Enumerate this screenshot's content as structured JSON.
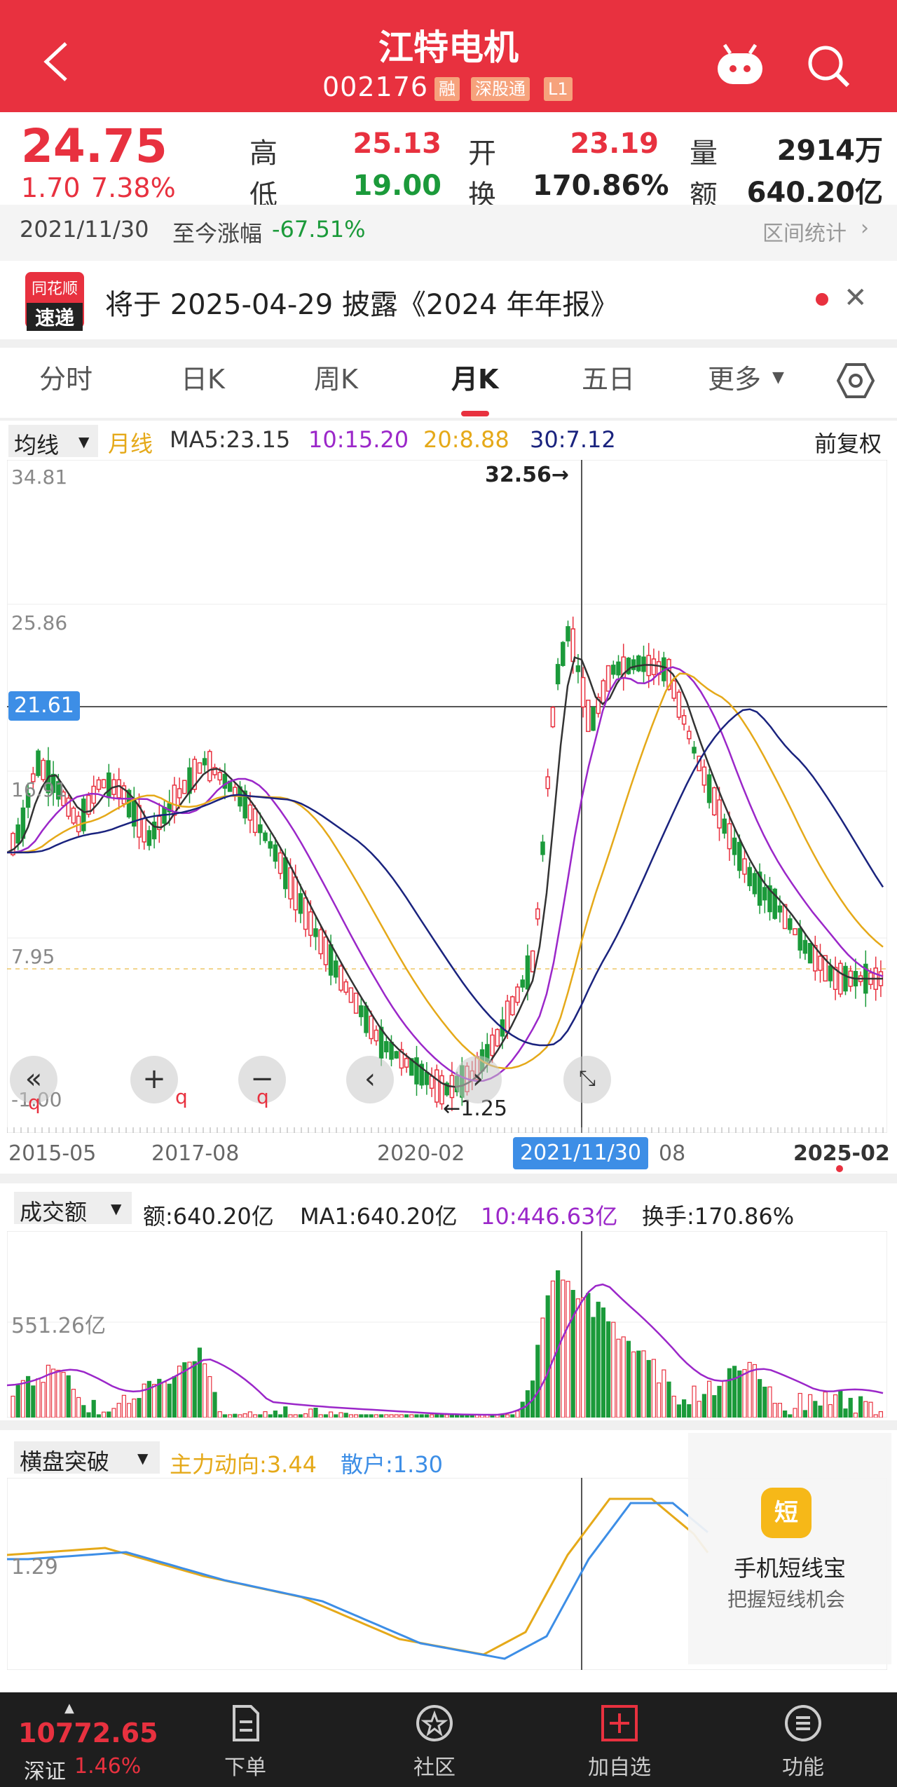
{
  "header": {
    "title": "江特电机",
    "code": "002176",
    "badges": [
      "融",
      "深股通",
      "L1"
    ]
  },
  "quote": {
    "price": "24.75",
    "change": "1.70",
    "change_pct": "7.38%",
    "high_label": "高",
    "high": "25.13",
    "open_label": "开",
    "open": "23.19",
    "volume_label": "量",
    "volume": "2914万",
    "low_label": "低",
    "low": "19.00",
    "turnover_label": "换",
    "turnover": "170.86%",
    "amount_label": "额",
    "amount": "640.20亿",
    "date": "2021/11/30",
    "since_label": "至今涨幅",
    "since_value": "-67.51%",
    "range_stats": "区间统计"
  },
  "news": {
    "logo_top": "同花顺",
    "logo_bottom": "速递",
    "text": "将于 2025-04-29 披露《2024 年年报》"
  },
  "tabs": [
    "分时",
    "日K",
    "周K",
    "月K",
    "五日",
    "更多"
  ],
  "active_tab": "月K",
  "kline": {
    "indicator": "均线",
    "period": "月线",
    "ma5": "MA5:23.15",
    "ma10": "10:15.20",
    "ma20": "20:8.88",
    "ma30": "30:7.12",
    "adjust": "前复权",
    "y_ticks": [
      "34.81",
      "25.86",
      "16.91",
      "7.95",
      "-1.00"
    ],
    "crosshair_price": "21.61",
    "max_marker": "32.56→",
    "min_marker": "←1.25",
    "x_ticks": [
      "2015-05",
      "2017-08",
      "2020-02",
      "08",
      "2025-02"
    ],
    "crosshair_date": "2021/11/30",
    "colors": {
      "ma5": "#333333",
      "ma10": "#9b27c9",
      "ma20": "#e5a919",
      "ma30": "#1a237e",
      "up": "#e8313f",
      "down": "#1b9a3a"
    }
  },
  "volume": {
    "indicator": "成交额",
    "amount": "额:640.20亿",
    "ma1": "MA1:640.20亿",
    "ma10": "10:446.63亿",
    "turnover": "换手:170.86%",
    "y_tick": "551.26亿"
  },
  "signal": {
    "indicator": "横盘突破",
    "main": "主力动向:3.44",
    "retail": "散户:1.30",
    "y_tick": "1.29",
    "promo_icon": "短",
    "promo_title": "手机短线宝",
    "promo_sub": "把握短线机会"
  },
  "bottom_nav": {
    "index_value": "10772.65",
    "index_name": "深证",
    "index_pct": "1.46%",
    "items": [
      "下单",
      "社区",
      "加自选",
      "功能"
    ]
  }
}
